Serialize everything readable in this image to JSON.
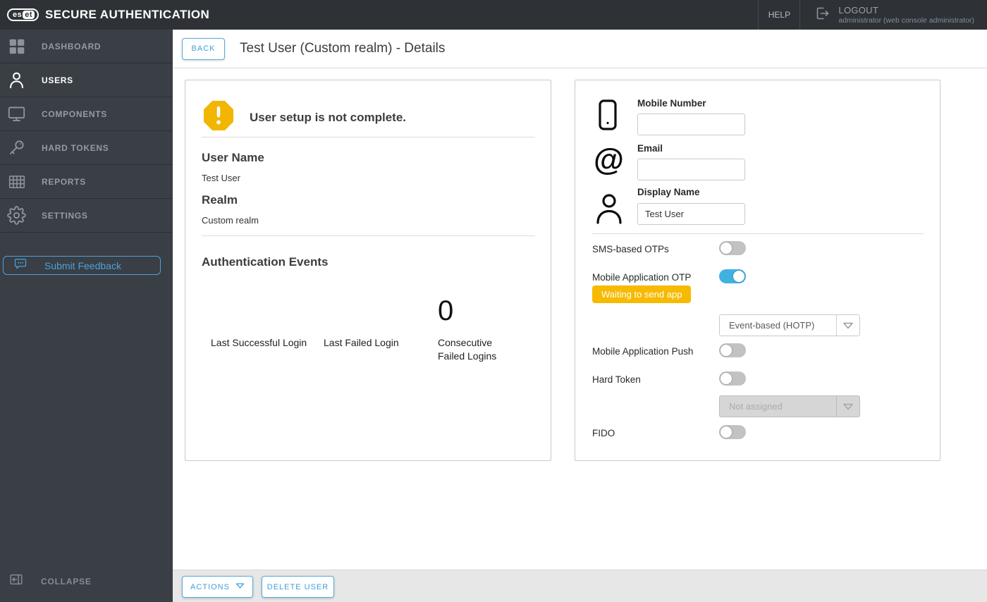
{
  "topbar": {
    "logo_text_1": "es",
    "logo_text_2": "et",
    "brand": "SECURE AUTHENTICATION",
    "help_label": "HELP",
    "logout_label": "LOGOUT",
    "logout_sub": "administrator (web console administrator)"
  },
  "sidebar": {
    "items": [
      {
        "label": "DASHBOARD",
        "icon": "dashboard-grid-icon",
        "active": false
      },
      {
        "label": "USERS",
        "icon": "user-icon",
        "active": true
      },
      {
        "label": "COMPONENTS",
        "icon": "monitor-icon",
        "active": false
      },
      {
        "label": "HARD TOKENS",
        "icon": "key-icon",
        "active": false
      },
      {
        "label": "REPORTS",
        "icon": "report-grid-icon",
        "active": false
      },
      {
        "label": "SETTINGS",
        "icon": "gear-icon",
        "active": false
      }
    ],
    "feedback_label": "Submit Feedback",
    "collapse_label": "COLLAPSE"
  },
  "header": {
    "back_label": "BACK",
    "title": "Test User (Custom realm) - Details"
  },
  "summary_card": {
    "warning_text": "User setup is not complete.",
    "username_label": "User Name",
    "username_value": "Test User",
    "realm_label": "Realm",
    "realm_value": "Custom realm",
    "auth_events_title": "Authentication Events",
    "stats": [
      {
        "label": "Last Successful Login",
        "value": ""
      },
      {
        "label": "Last Failed Login",
        "value": ""
      },
      {
        "label": "Consecutive Failed Logins",
        "value": "0"
      }
    ]
  },
  "detail_card": {
    "mobile_number_label": "Mobile Number",
    "mobile_number_value": "",
    "email_label": "Email",
    "email_value": "",
    "display_name_label": "Display Name",
    "display_name_value": "Test User",
    "toggles": {
      "sms": {
        "label": "SMS-based OTPs",
        "state": "off"
      },
      "mobile_otp": {
        "label": "Mobile Application OTP",
        "state": "on"
      },
      "push": {
        "label": "Mobile Application Push",
        "state": "off"
      },
      "hard_token": {
        "label": "Hard Token",
        "state": "off"
      },
      "fido": {
        "label": "FIDO",
        "state": "off"
      }
    },
    "waiting_badge": "Waiting to send app",
    "otp_type_select": {
      "value": "Event-based (HOTP)",
      "disabled": false
    },
    "hard_token_select": {
      "value": "Not assigned",
      "disabled": true
    }
  },
  "footer": {
    "actions_label": "ACTIONS",
    "delete_label": "DELETE USER"
  },
  "colors": {
    "topbar_bg": "#2e3237",
    "sidebar_bg": "#3a3e45",
    "accent_blue": "#3f9fd8",
    "toggle_on_blue": "#41b1e1",
    "warning_amber": "#f2b500",
    "badge_amber": "#f6ba00",
    "footer_bg": "#e7e7e7"
  }
}
